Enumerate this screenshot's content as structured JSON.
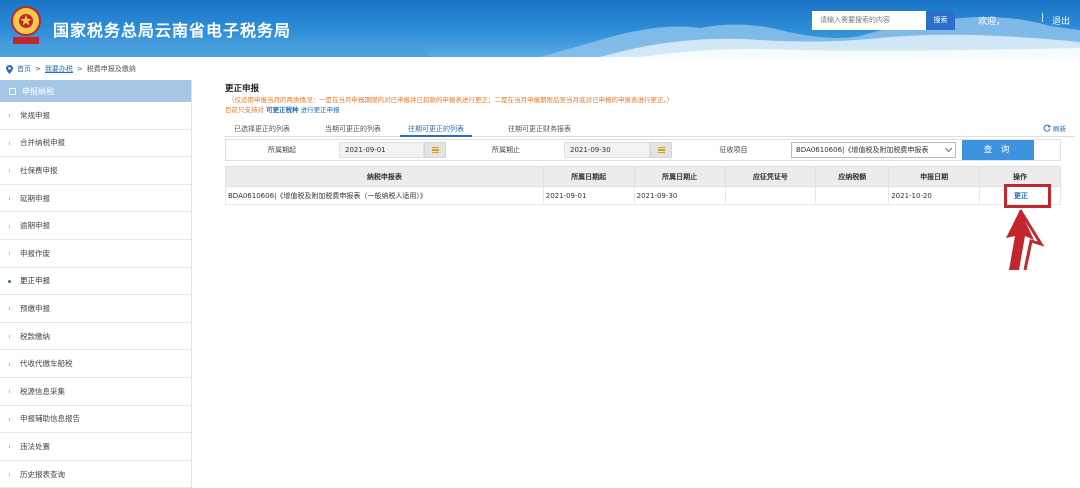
{
  "header": {
    "site_title": "国家税务总局云南省电子税务局",
    "search_placeholder": "请输入需要搜索的内容",
    "search_button": "搜索",
    "welcome": "欢迎，",
    "separator": "|",
    "logout": "退出"
  },
  "breadcrumb": {
    "home": "首页",
    "sep1": ">",
    "mytax": "我要办税",
    "sep2": ">",
    "current": "税费申报及缴纳"
  },
  "sidebar": {
    "header": "申报纳税",
    "items": [
      {
        "label": "常规申报"
      },
      {
        "label": "合并纳税申报"
      },
      {
        "label": "社保费申报"
      },
      {
        "label": "延期申报"
      },
      {
        "label": "逾期申报"
      },
      {
        "label": "申报作废"
      },
      {
        "label": "更正申报"
      },
      {
        "label": "预缴申报"
      },
      {
        "label": "税款缴纳"
      },
      {
        "label": "代收代缴车船税"
      },
      {
        "label": "税源信息采集"
      },
      {
        "label": "申报辅助信息报告"
      },
      {
        "label": "违法处置"
      },
      {
        "label": "历史报表查询"
      }
    ],
    "active_index": 6
  },
  "main": {
    "title": "更正申报",
    "notice": "（仅适用申报当月的两类情况：一是在当月申报期限内对已申报并已扣款的申报表进行更正；二是在当月申报期限后至当月底对已申报的申报表进行更正。）",
    "support_prefix": "目前只支持对",
    "support_highlight": "可更正税种",
    "support_suffix": "进行更正申报",
    "tabs": [
      {
        "label": "已选择更正的列表"
      },
      {
        "label": "当期可更正的列表"
      },
      {
        "label": "往期可更正的列表"
      },
      {
        "label": "往期可更正财务报表"
      }
    ],
    "active_tab": 2,
    "refresh": "刷新",
    "filter": {
      "period_start_label": "所属期起",
      "period_start_value": "2021-09-01",
      "period_end_label": "所属期止",
      "period_end_value": "2021-09-30",
      "item_label": "征收项目",
      "item_value": "BDA0610606|《增值税及附加税费申报表",
      "query_button": "查 询"
    },
    "table": {
      "headers": [
        "纳税申报表",
        "所属日期起",
        "所属日期止",
        "应征凭证号",
        "应纳税额",
        "申报日期",
        "操作"
      ],
      "rows": [
        {
          "form": "BDA0610606|《增值税及附加税费申报表（一般纳税人适用）》",
          "start": "2021-09-01",
          "end": "2021-09-30",
          "voucher": "",
          "tax": "",
          "date": "2021-10-20",
          "action": "更正"
        }
      ]
    }
  },
  "colors": {
    "header_blue": "#2f8fd8",
    "sidebar_head": "#a6c6e6",
    "link_blue": "#2a6db8",
    "notice_orange": "#e57a2c",
    "annotation_red": "#c1272d",
    "query_button": "#3d93e0"
  }
}
